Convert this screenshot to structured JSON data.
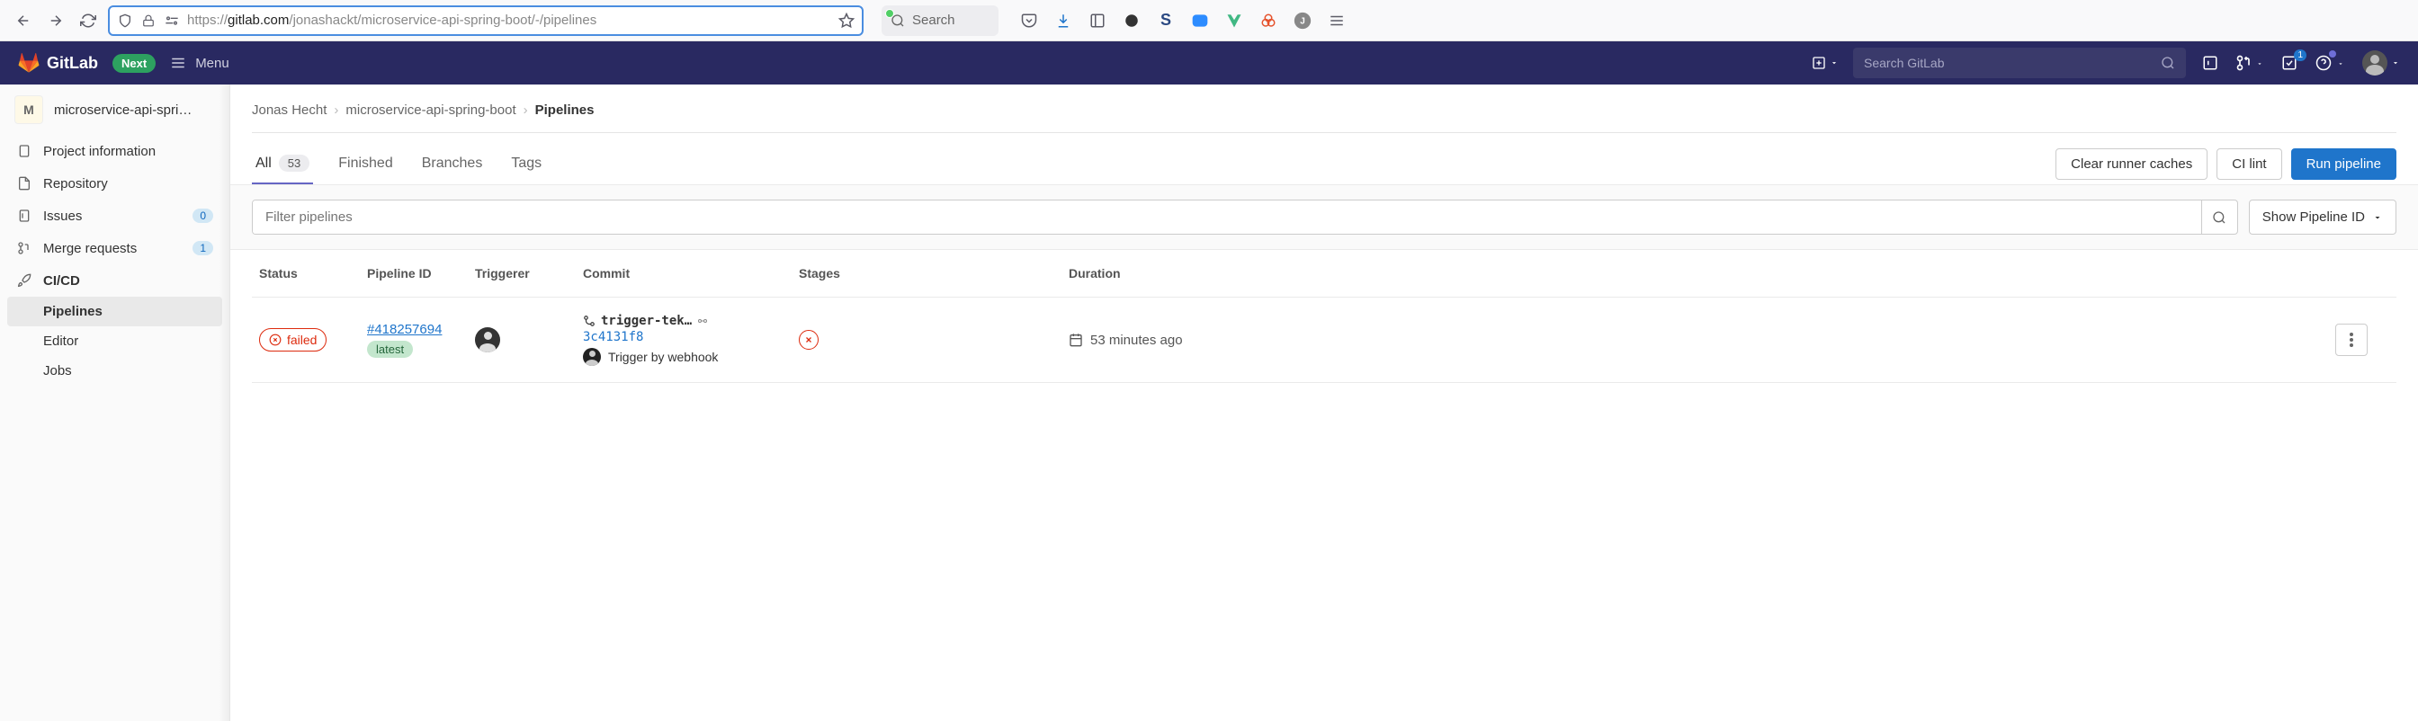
{
  "browser": {
    "url_prefix": "https://",
    "url_host": "gitlab.com",
    "url_path": "/jonashackt/microservice-api-spring-boot/-/pipelines",
    "search_placeholder": "Search"
  },
  "header": {
    "brand": "GitLab",
    "next_label": "Next",
    "menu_label": "Menu",
    "search_placeholder": "Search GitLab",
    "todos_badge": "1"
  },
  "sidebar": {
    "project_letter": "M",
    "project_name": "microservice-api-spri…",
    "items": {
      "project_info": "Project information",
      "repository": "Repository",
      "issues": "Issues",
      "issues_count": "0",
      "merge_requests": "Merge requests",
      "mr_count": "1",
      "cicd": "CI/CD",
      "pipelines": "Pipelines",
      "editor": "Editor",
      "jobs": "Jobs"
    }
  },
  "breadcrumb": {
    "user": "Jonas Hecht",
    "project": "microservice-api-spring-boot",
    "current": "Pipelines"
  },
  "tabs": {
    "all": "All",
    "all_count": "53",
    "finished": "Finished",
    "branches": "Branches",
    "tags": "Tags"
  },
  "actions": {
    "clear_caches": "Clear runner caches",
    "ci_lint": "CI lint",
    "run_pipeline": "Run pipeline"
  },
  "filter": {
    "placeholder": "Filter pipelines",
    "show_id": "Show Pipeline ID"
  },
  "table": {
    "headers": {
      "status": "Status",
      "pipeline_id": "Pipeline ID",
      "triggerer": "Triggerer",
      "commit": "Commit",
      "stages": "Stages",
      "duration": "Duration"
    },
    "row": {
      "status": "failed",
      "pipeline_id": "#418257694",
      "latest": "latest",
      "branch": "trigger-tek…",
      "sha": "3c4131f8",
      "trigger_text": "Trigger by webhook",
      "duration": "53 minutes ago"
    }
  }
}
